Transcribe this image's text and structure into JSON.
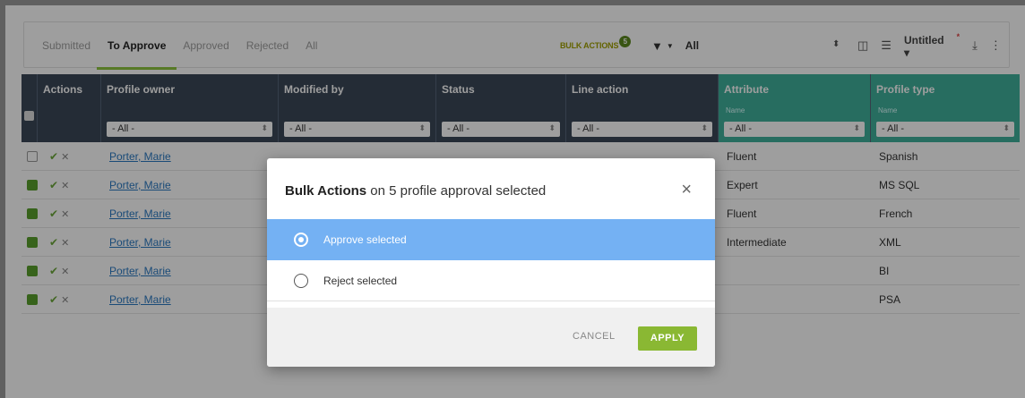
{
  "tabs": [
    "Submitted",
    "To Approve",
    "Approved",
    "Rejected",
    "All"
  ],
  "bulk_actions": {
    "label": "BULK ACTIONS",
    "count": "5"
  },
  "filter": {
    "value": "All"
  },
  "view": {
    "name": "Untitled",
    "modified_mark": "*"
  },
  "columns": {
    "actions": "Actions",
    "profile_owner": "Profile owner",
    "modified_by": "Modified by",
    "status": "Status",
    "line_action": "Line action",
    "attribute": "Attribute",
    "attribute_sub": "Name",
    "profile_type": "Profile type",
    "profile_type_sub": "Name",
    "filter_all": "- All -"
  },
  "rows": [
    {
      "checked": false,
      "owner": "Porter, Marie",
      "attribute": "Fluent",
      "profile_type": "Spanish"
    },
    {
      "checked": true,
      "owner": "Porter, Marie",
      "attribute": "Expert",
      "profile_type": "MS SQL"
    },
    {
      "checked": true,
      "owner": "Porter, Marie",
      "attribute": "Fluent",
      "profile_type": "French"
    },
    {
      "checked": true,
      "owner": "Porter, Marie",
      "attribute": "Intermediate",
      "profile_type": "XML"
    },
    {
      "checked": true,
      "owner": "Porter, Marie",
      "attribute": "",
      "profile_type": "BI"
    },
    {
      "checked": true,
      "owner": "Porter, Marie",
      "attribute": "",
      "profile_type": "PSA"
    }
  ],
  "modal": {
    "title_bold": "Bulk Actions",
    "title_rest": " on 5 profile approval selected",
    "close": "×",
    "options": [
      "Approve selected",
      "Reject selected"
    ],
    "selected_option": "Approve selected",
    "cancel": "CANCEL",
    "apply": "APPLY"
  },
  "colors": {
    "accent": "#8dc63f",
    "header": "#3b4858",
    "teal": "#3fb19b",
    "selected": "#74b1f3",
    "apply": "#8ab833",
    "link": "#2b79c2"
  }
}
